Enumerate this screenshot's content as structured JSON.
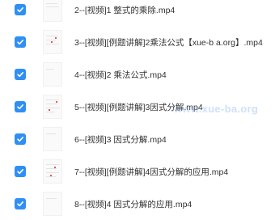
{
  "files": [
    {
      "name": "2--[视频]1 整式的乘除.mp4",
      "checked": true
    },
    {
      "name": "3--[视频][例题讲解]2乘法公式【xue-b a.org】.mp4",
      "checked": true
    },
    {
      "name": "4--[视频]2 乘法公式.mp4",
      "checked": true
    },
    {
      "name": "5--[视频][例题讲解]3因式分解.mp4",
      "checked": true
    },
    {
      "name": "6--[视频]3 因式分解.mp4",
      "checked": true
    },
    {
      "name": "7--[视频][例题讲解]4因式分解的应用.mp4",
      "checked": true
    },
    {
      "name": "8--[视频]4 因式分解的应用.mp4",
      "checked": true
    }
  ],
  "watermark": "www.xue-ba.org",
  "colors": {
    "checkbox": "#2f8ff4",
    "text": "#333333"
  }
}
